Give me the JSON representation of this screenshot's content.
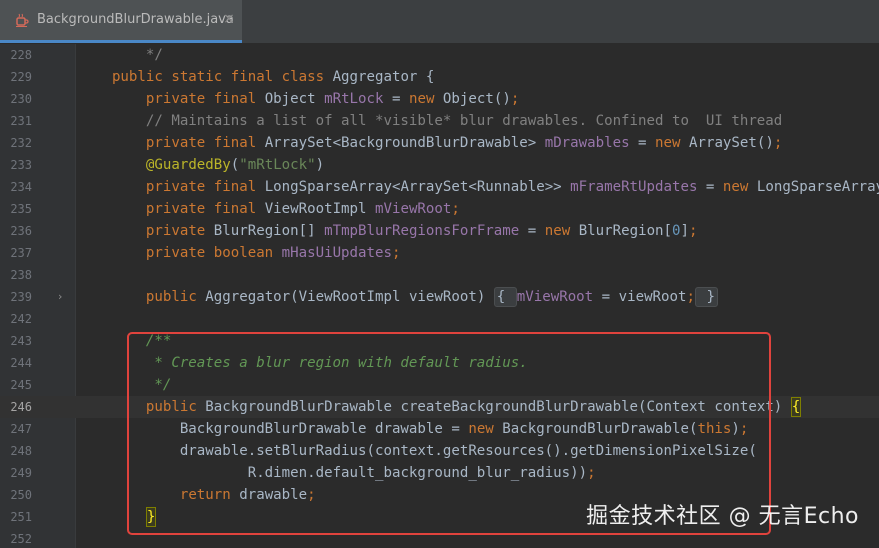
{
  "tab": {
    "title": "BackgroundBlurDrawable.java",
    "file_icon": "java-file-icon",
    "close_glyph": "×"
  },
  "lines": [
    {
      "num": "228",
      "current": false,
      "fold": "",
      "tokens": [
        [
          "cm",
          "        */"
        ]
      ]
    },
    {
      "num": "229",
      "current": false,
      "fold": "",
      "tokens": [
        [
          "kw",
          "    public static final class "
        ],
        [
          "",
          "Aggregator {"
        ]
      ]
    },
    {
      "num": "230",
      "current": false,
      "fold": "",
      "tokens": [
        [
          "",
          "        "
        ],
        [
          "kw",
          "private final "
        ],
        [
          "",
          "Object "
        ],
        [
          "fld",
          "mRtLock"
        ],
        [
          "",
          " = "
        ],
        [
          "kw",
          "new "
        ],
        [
          "",
          "Object()"
        ],
        [
          "kw",
          ";"
        ]
      ]
    },
    {
      "num": "231",
      "current": false,
      "fold": "",
      "tokens": [
        [
          "cm",
          "        // Maintains a list of all *visible* blur drawables. Confined to  UI thread"
        ]
      ]
    },
    {
      "num": "232",
      "current": false,
      "fold": "",
      "tokens": [
        [
          "",
          "        "
        ],
        [
          "kw",
          "private final "
        ],
        [
          "",
          "ArraySet<BackgroundBlurDrawable> "
        ],
        [
          "fld",
          "mDrawables"
        ],
        [
          "",
          " = "
        ],
        [
          "kw",
          "new "
        ],
        [
          "",
          "ArraySet()"
        ],
        [
          "kw",
          ";"
        ]
      ]
    },
    {
      "num": "233",
      "current": false,
      "fold": "",
      "tokens": [
        [
          "",
          "        "
        ],
        [
          "ann",
          "@GuardedBy"
        ],
        [
          "",
          "("
        ],
        [
          "str",
          "\"mRtLock\""
        ],
        [
          "",
          ")"
        ]
      ]
    },
    {
      "num": "234",
      "current": false,
      "fold": "",
      "tokens": [
        [
          "",
          "        "
        ],
        [
          "kw",
          "private final "
        ],
        [
          "",
          "LongSparseArray<ArraySet<Runnable>> "
        ],
        [
          "fld",
          "mFrameRtUpdates"
        ],
        [
          "",
          " = "
        ],
        [
          "kw",
          "new "
        ],
        [
          "",
          "LongSparseArray()"
        ],
        [
          "kw",
          ";"
        ]
      ]
    },
    {
      "num": "235",
      "current": false,
      "fold": "",
      "tokens": [
        [
          "",
          "        "
        ],
        [
          "kw",
          "private final "
        ],
        [
          "",
          "ViewRootImpl "
        ],
        [
          "fld",
          "mViewRoot"
        ],
        [
          "kw",
          ";"
        ]
      ]
    },
    {
      "num": "236",
      "current": false,
      "fold": "",
      "tokens": [
        [
          "",
          "        "
        ],
        [
          "kw",
          "private "
        ],
        [
          "",
          "BlurRegion[] "
        ],
        [
          "fld",
          "mTmpBlurRegionsForFrame"
        ],
        [
          "",
          " = "
        ],
        [
          "kw",
          "new "
        ],
        [
          "",
          "BlurRegion["
        ],
        [
          "num",
          "0"
        ],
        [
          "",
          "]"
        ],
        [
          "kw",
          ";"
        ]
      ]
    },
    {
      "num": "237",
      "current": false,
      "fold": "",
      "tokens": [
        [
          "",
          "        "
        ],
        [
          "kw",
          "private boolean "
        ],
        [
          "fld",
          "mHasUiUpdates"
        ],
        [
          "kw",
          ";"
        ]
      ]
    },
    {
      "num": "238",
      "current": false,
      "fold": "",
      "tokens": []
    },
    {
      "num": "239",
      "current": false,
      "fold": "›",
      "tokens": [
        [
          "",
          "        "
        ],
        [
          "kw",
          "public "
        ],
        [
          "",
          "Aggregator(ViewRootImpl viewRoot) "
        ],
        [
          "fold",
          "{ "
        ],
        [
          "fld",
          "mViewRoot"
        ],
        [
          "",
          " = viewRoot"
        ],
        [
          "kw",
          ";"
        ],
        [
          "fold",
          " }"
        ]
      ]
    },
    {
      "num": "242",
      "current": false,
      "fold": "",
      "tokens": []
    },
    {
      "num": "243",
      "current": false,
      "fold": "",
      "tokens": [
        [
          "doc",
          "        /**"
        ]
      ]
    },
    {
      "num": "244",
      "current": false,
      "fold": "",
      "tokens": [
        [
          "doc",
          "         * Creates a blur region with default radius."
        ]
      ]
    },
    {
      "num": "245",
      "current": false,
      "fold": "",
      "tokens": [
        [
          "doc",
          "         */"
        ]
      ]
    },
    {
      "num": "246",
      "current": true,
      "fold": "",
      "tokens": [
        [
          "",
          "        "
        ],
        [
          "kw",
          "public "
        ],
        [
          "",
          "BackgroundBlurDrawable createBackgroundBlurDrawable(Context context) "
        ],
        [
          "brace",
          "{"
        ]
      ]
    },
    {
      "num": "247",
      "current": false,
      "fold": "",
      "tokens": [
        [
          "",
          "            BackgroundBlurDrawable drawable = "
        ],
        [
          "kw",
          "new "
        ],
        [
          "",
          "BackgroundBlurDrawable("
        ],
        [
          "kw",
          "this"
        ],
        [
          "",
          ")"
        ],
        [
          "kw",
          ";"
        ]
      ]
    },
    {
      "num": "248",
      "current": false,
      "fold": "",
      "tokens": [
        [
          "",
          "            drawable.setBlurRadius(context.getResources().getDimensionPixelSize("
        ]
      ]
    },
    {
      "num": "249",
      "current": false,
      "fold": "",
      "tokens": [
        [
          "",
          "                    R.dimen."
        ],
        [
          "",
          "default_background_blur_radius))"
        ],
        [
          "kw",
          ";"
        ]
      ]
    },
    {
      "num": "250",
      "current": false,
      "fold": "",
      "tokens": [
        [
          "",
          "            "
        ],
        [
          "kw",
          "return "
        ],
        [
          "",
          "drawable"
        ],
        [
          "kw",
          ";"
        ]
      ]
    },
    {
      "num": "251",
      "current": false,
      "fold": "",
      "tokens": [
        [
          "",
          "        "
        ],
        [
          "brace",
          "}"
        ]
      ]
    },
    {
      "num": "252",
      "current": false,
      "fold": "",
      "tokens": []
    }
  ],
  "highlight": {
    "color": "#e0433d"
  },
  "watermark": "掘金技术社区 @ 无言Echo",
  "colors": {
    "background": "#2b2b2b",
    "gutter": "#313335",
    "keyword": "#cc7832",
    "string": "#6a8759",
    "comment": "#808080",
    "doc_comment": "#629755",
    "annotation": "#bbb529",
    "field": "#9876aa",
    "tab_accent": "#4a88c7"
  }
}
